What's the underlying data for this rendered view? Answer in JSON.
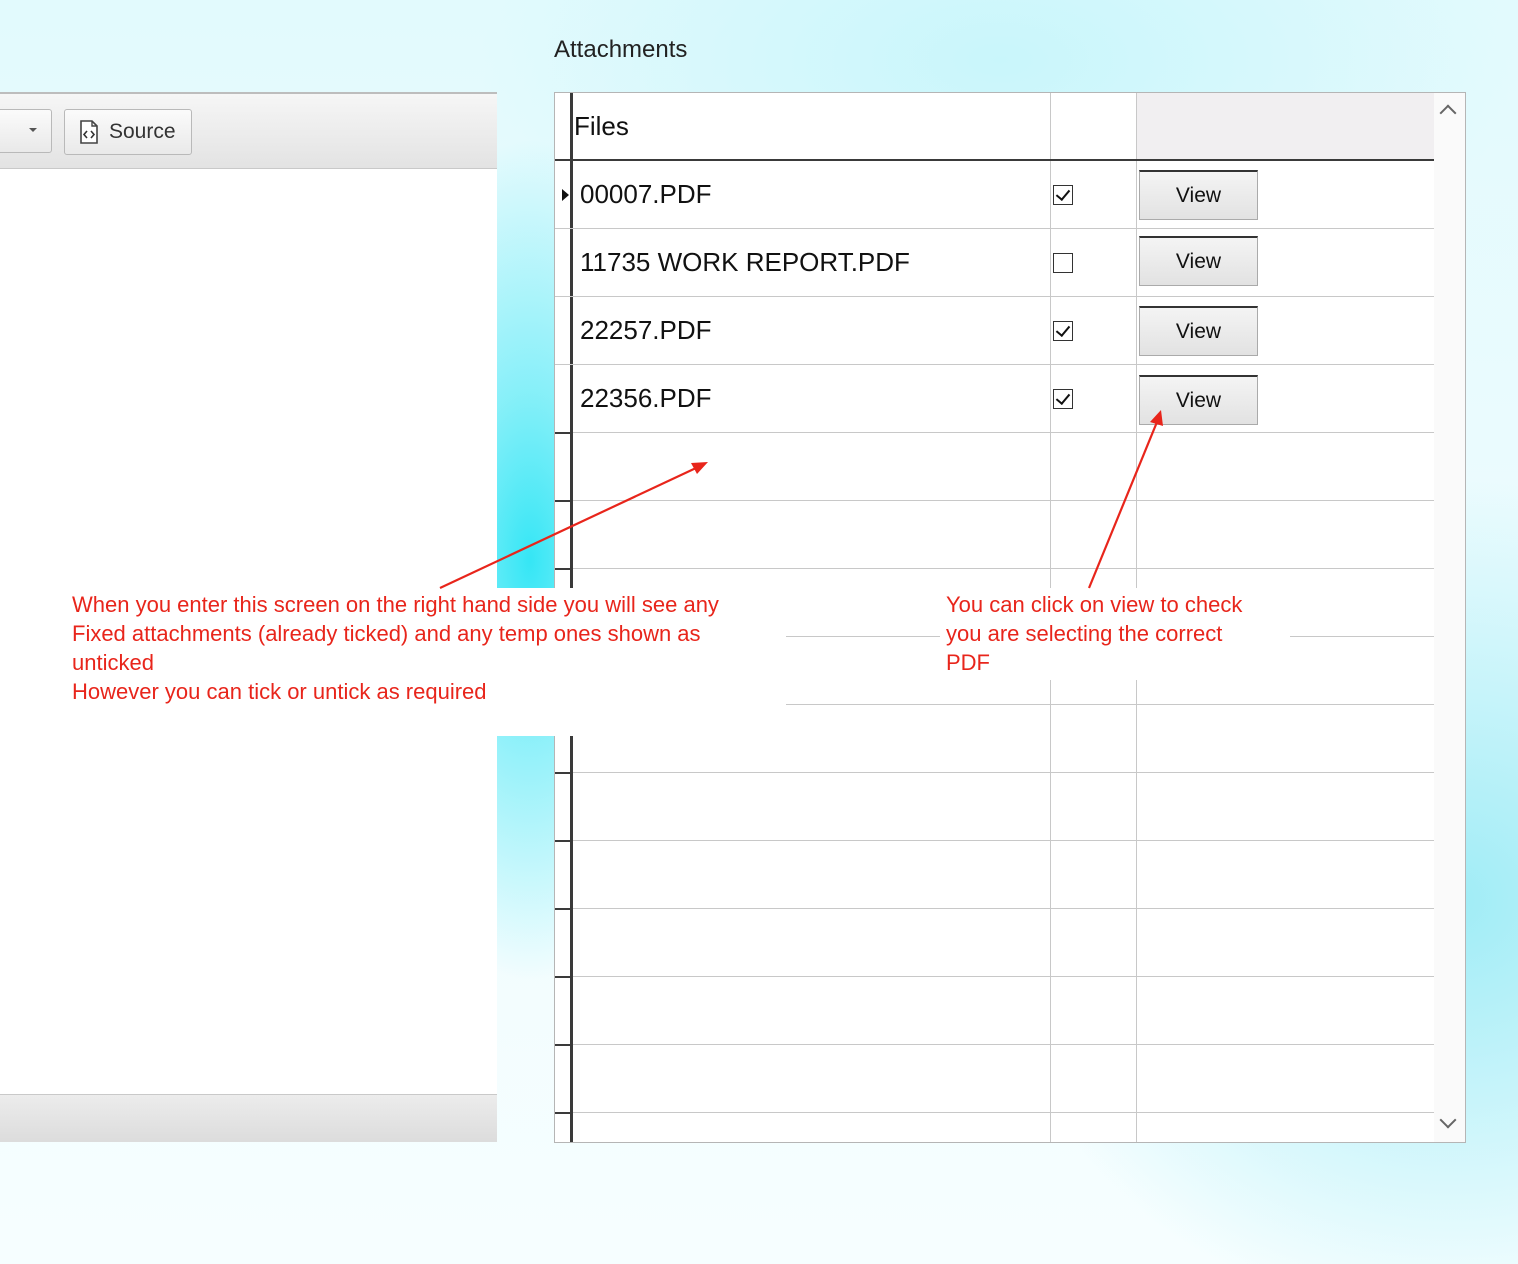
{
  "editor": {
    "source_label": "Source"
  },
  "attachments": {
    "title": "Attachments",
    "column_files": "Files",
    "rows": [
      {
        "file": "00007.PDF",
        "checked": true,
        "view_label": "View"
      },
      {
        "file": "11735 WORK REPORT.PDF",
        "checked": false,
        "view_label": "View"
      },
      {
        "file": "22257.PDF",
        "checked": true,
        "view_label": "View"
      },
      {
        "file": "22356.PDF",
        "checked": true,
        "view_label": "View"
      }
    ]
  },
  "annotations": {
    "left_note": "When you enter this screen on the right hand side you will see any\nFixed attachments (already ticked) and any temp ones shown as\nunticked\nHowever you can tick or untick as required",
    "right_note": "You can click on view to check\nyou are selecting the correct\nPDF"
  },
  "colors": {
    "annotation": "#e8251b",
    "accent_background": "#35e6f5"
  },
  "icons": {
    "source": "source-code-icon",
    "dropdown": "chevron-down-icon",
    "scroll_up": "chevron-up-icon",
    "scroll_down": "chevron-down-icon"
  }
}
